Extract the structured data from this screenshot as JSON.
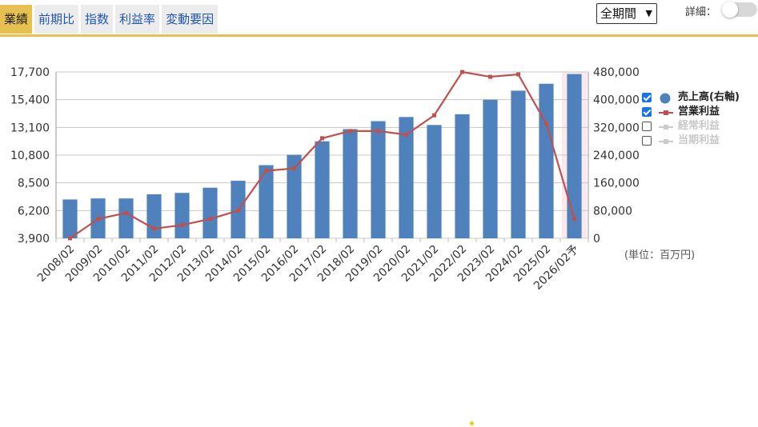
{
  "tabs": [
    {
      "label": "業績",
      "active": true
    },
    {
      "label": "前期比",
      "active": false
    },
    {
      "label": "指数",
      "active": false
    },
    {
      "label": "利益率",
      "active": false
    },
    {
      "label": "変動要因",
      "active": false
    }
  ],
  "period_select": {
    "value": "全期間"
  },
  "detail_toggle": {
    "label": "詳細：",
    "on": false
  },
  "unit_label": "(単位：百万円)",
  "colors": {
    "accent": "#e7c14f",
    "bar": "#4f81bd",
    "line": "#c0504d",
    "disabled": "#cccccc",
    "check": "#1a73e8",
    "highlight": "#fde9ec"
  },
  "legend": [
    {
      "label": "売上高(右軸)",
      "checked": true,
      "symbol": "circle",
      "color": "#4f81bd"
    },
    {
      "label": "営業利益",
      "checked": true,
      "symbol": "line",
      "color": "#c0504d"
    },
    {
      "label": "経常利益",
      "checked": false,
      "symbol": "line",
      "color": "#cccccc"
    },
    {
      "label": "当期利益",
      "checked": false,
      "symbol": "line",
      "color": "#cccccc"
    }
  ],
  "chart_data": {
    "type": "bar",
    "categories": [
      "2008/02",
      "2009/02",
      "2010/02",
      "2011/02",
      "2012/02",
      "2013/02",
      "2014/02",
      "2015/02",
      "2016/02",
      "2017/02",
      "2018/02",
      "2019/02",
      "2020/02",
      "2021/02",
      "2022/02",
      "2023/02",
      "2024/02",
      "2025/02",
      "2026/02予"
    ],
    "series": [
      {
        "name": "売上高(右軸)",
        "type": "bar",
        "axis": "right",
        "values": [
          112000,
          115000,
          115000,
          127000,
          131000,
          146000,
          166000,
          211000,
          241000,
          280000,
          315000,
          338000,
          350000,
          327000,
          358000,
          400000,
          426000,
          446000,
          474000
        ]
      },
      {
        "name": "営業利益",
        "type": "line",
        "axis": "left",
        "values": [
          3900,
          5500,
          6000,
          4700,
          5000,
          5500,
          6200,
          9500,
          9700,
          12200,
          12800,
          12800,
          12500,
          14100,
          17700,
          17300,
          17500,
          13400,
          5500
        ]
      }
    ],
    "left_axis": {
      "min": 3900,
      "max": 17700,
      "ticks": [
        "3,900",
        "6,200",
        "8,500",
        "10,800",
        "13,100",
        "15,400",
        "17,700"
      ]
    },
    "right_axis": {
      "min": 0,
      "max": 480000,
      "ticks": [
        "0",
        "80,000",
        "160,000",
        "240,000",
        "320,000",
        "400,000",
        "480,000"
      ]
    },
    "highlight_category": "2026/02予",
    "grid": true,
    "legend_position": "right"
  }
}
